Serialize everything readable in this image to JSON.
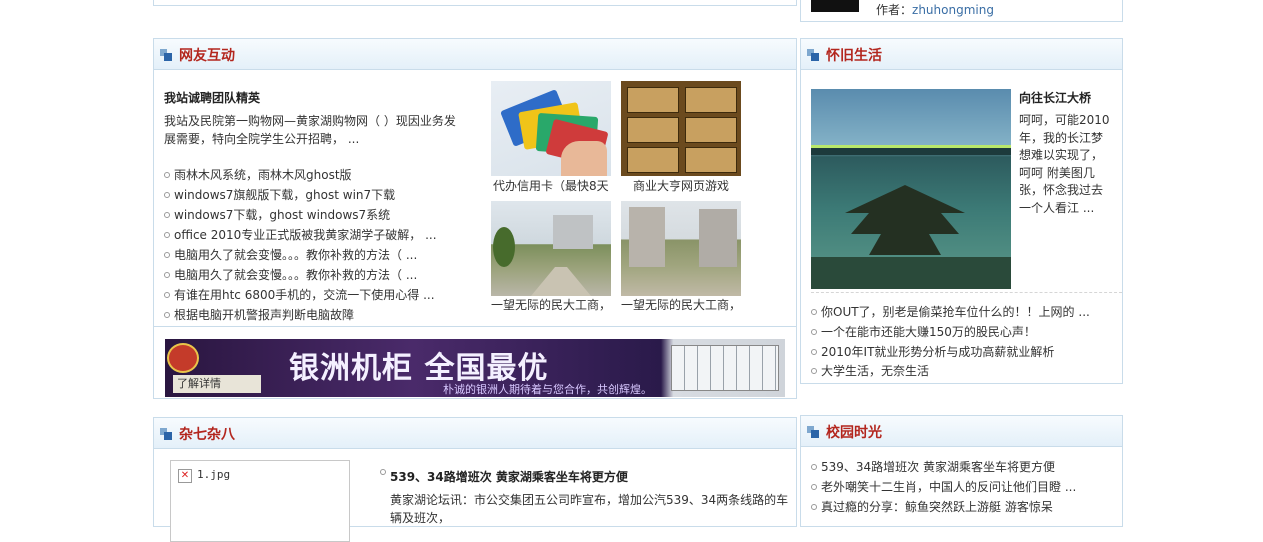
{
  "top_right": {
    "author_label": "作者：",
    "author_name": "zhuhongming"
  },
  "netfriend": {
    "title": "网友互动",
    "headline": "我站诚聘团队精英",
    "intro": "我站及民院第一购物网—黄家湖购物网（ ）现因业务发展需要，特向全院学生公开招聘， ...",
    "links": [
      "雨林木风系统，雨林木风ghost版",
      "windows7旗舰版下载，ghost win7下载",
      "windows7下载，ghost windows7系统",
      "office 2010专业正式版被我黄家湖学子破解， ...",
      "电脑用久了就会变慢。。。教你补救的方法（ ...",
      "电脑用久了就会变慢。。。教你补救的方法（ ...",
      "有谁在用htc 6800手机的，交流一下使用心得 ...",
      "根据电脑开机警报声判断电脑故障"
    ],
    "thumbs": [
      {
        "caption": "代办信用卡（最快8天"
      },
      {
        "caption": "商业大亨网页游戏"
      },
      {
        "caption": "一望无际的民大工商，"
      },
      {
        "caption": "一望无际的民大工商，"
      }
    ],
    "banner": {
      "main_text": "银洲机柜 全国最优",
      "sub_text": "朴诚的银洲人期待着与您合作，共创辉煌。",
      "button": "了解详情"
    }
  },
  "nostalgia": {
    "title": "怀旧生活",
    "feature_title": "向往长江大桥",
    "feature_text": "呵呵，可能2010年，我的长江梦想难以实现了，呵呵 附美图几张，怀念我过去一个人看江 ...",
    "links": [
      "你OUT了，别老是偷菜抢车位什么的！！上网的 ...",
      "一个在能市还能大赚150万的股民心声！",
      "2010年IT就业形势分析与成功高薪就业解析",
      "大学生活，无奈生活"
    ]
  },
  "misc": {
    "title": "杂七杂八",
    "image_alt": "1.jpg",
    "headline": "539、34路增班次 黄家湖乘客坐车将更方便",
    "text": "黄家湖论坛讯：市公交集团五公司昨宣布，增加公汽539、34两条线路的车辆及班次，"
  },
  "campus": {
    "title": "校园时光",
    "links": [
      "539、34路增班次 黄家湖乘客坐车将更方便",
      "老外嘲笑十二生肖，中国人的反问让他们目瞪 ...",
      "真过瘾的分享：鲸鱼突然跃上游艇 游客惊呆"
    ]
  }
}
